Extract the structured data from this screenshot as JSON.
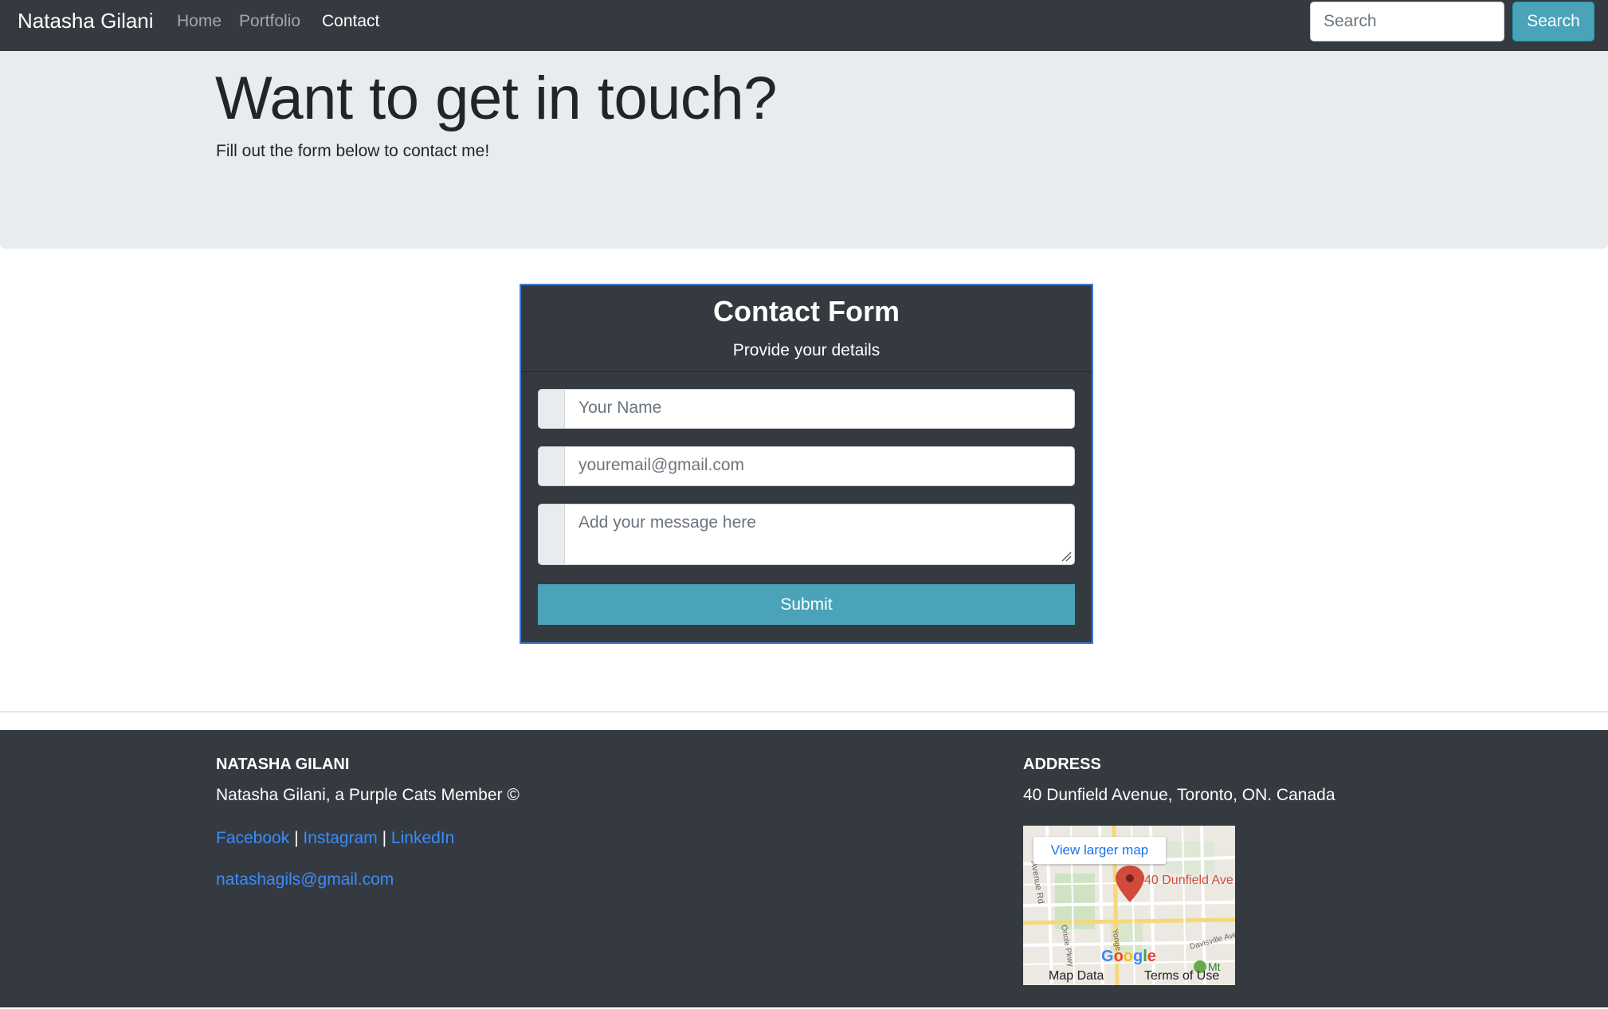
{
  "navbar": {
    "brand": "Natasha Gilani",
    "links": [
      {
        "label": "Home",
        "active": false
      },
      {
        "label": "Portfolio",
        "active": false
      },
      {
        "label": "Contact",
        "active": true
      }
    ],
    "search_placeholder": "Search",
    "search_button": "Search"
  },
  "hero": {
    "title": "Want to get in touch?",
    "subtitle": "Fill out the form below to contact me!"
  },
  "contact_form": {
    "title": "Contact Form",
    "subtitle": "Provide your details",
    "name_placeholder": "Your Name",
    "email_placeholder": "youremail@gmail.com",
    "message_placeholder": "Add your message here",
    "submit_label": "Submit"
  },
  "footer": {
    "left": {
      "heading": "NATASHA GILANI",
      "tagline": "Natasha Gilani, a Purple Cats Member ©",
      "social": [
        "Facebook",
        "Instagram",
        "LinkedIn"
      ],
      "separator": "|",
      "email": "natashagils@gmail.com"
    },
    "right": {
      "heading": "ADDRESS",
      "address": "40 Dunfield Avenue, Toronto, ON. Canada",
      "map": {
        "button": "View larger map",
        "pin_label": "40 Dunfield Ave",
        "map_data": "Map Data",
        "terms": "Terms of Use",
        "logo": "Google",
        "streets": [
          "Avenue Rd",
          "Oriole Pkwy",
          "Yonge",
          "Davisville Ave"
        ],
        "place_label": "Mt"
      }
    }
  },
  "colors": {
    "navbar_bg": "#343a40",
    "jumbotron_bg": "#e9ecef",
    "accent_info": "#4aa3b8",
    "link": "#3d8bfd",
    "card_border": "#3d7dd6",
    "map_pin": "#d04b3b"
  }
}
